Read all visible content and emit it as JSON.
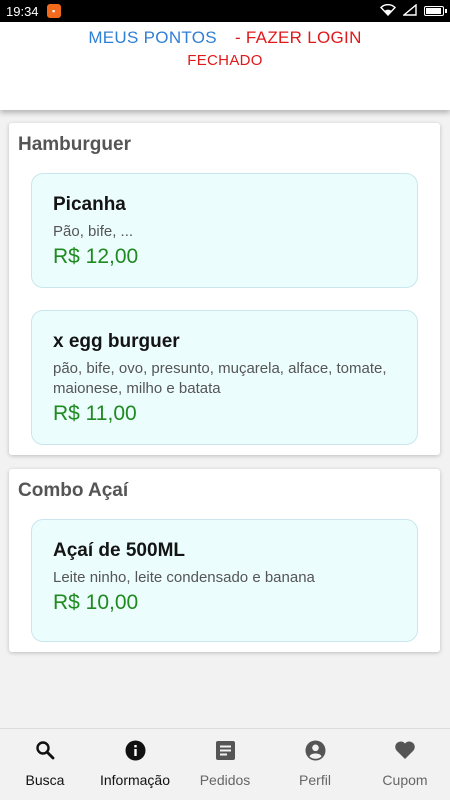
{
  "statusbar": {
    "time": "19:34",
    "notification_icon": "app-notification-icon"
  },
  "header": {
    "points_link": "MEUS PONTOS",
    "login_link": "- FAZER LOGIN",
    "store_status": "FECHADO",
    "colors": {
      "points": "#2f7fd6",
      "login": "#e0191b",
      "status": "#e0191b"
    }
  },
  "sections": [
    {
      "title": "Hamburguer",
      "items": [
        {
          "name": "Picanha",
          "description": "Pão, bife, ...",
          "price": "R$ 12,00"
        },
        {
          "name": "x egg burguer",
          "description": "pão, bife, ovo, presunto, muçarela, alface, tomate, maionese, milho e batata",
          "price": "R$ 11,00"
        }
      ]
    },
    {
      "title": "Combo Açaí",
      "items": [
        {
          "name": "Açaí de 500ML",
          "description": "Leite ninho, leite condensado e banana",
          "price": "R$ 10,00"
        }
      ]
    }
  ],
  "bottom_nav": {
    "items": [
      {
        "label": "Busca",
        "icon": "search-icon"
      },
      {
        "label": "Informação",
        "icon": "info-icon"
      },
      {
        "label": "Pedidos",
        "icon": "orders-icon"
      },
      {
        "label": "Perfil",
        "icon": "profile-icon"
      },
      {
        "label": "Cupom",
        "icon": "heart-icon"
      }
    ]
  },
  "colors": {
    "price": "#1f8a1f",
    "item_background": "#ecfdfe"
  }
}
